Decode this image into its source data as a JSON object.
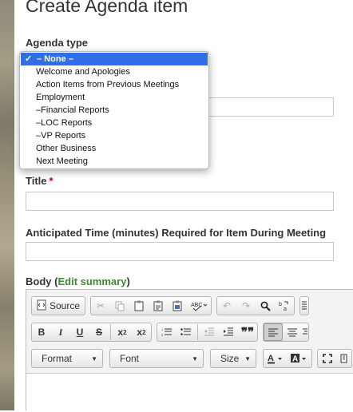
{
  "page_title": "Create Agenda item",
  "agenda_type": {
    "label": "Agenda type",
    "options": [
      "– None –",
      "Welcome and Apologies",
      "Action Items from Previous Meetings",
      "Employment",
      "–Financial Reports",
      "–LOC Reports",
      "–VP Reports",
      "Other Business",
      "Next Meeting"
    ],
    "selected": "– None –"
  },
  "title_field": {
    "label": "Title",
    "required_mark": "*"
  },
  "time_field": {
    "label": "Anticipated Time (minutes) Required for Item During Meeting"
  },
  "body": {
    "label": "Body",
    "edit_summary": "Edit summary",
    "open_paren": "(",
    "close_paren": ")"
  },
  "toolbar": {
    "source_label": "Source",
    "format_label": "Format",
    "font_label": "Font",
    "size_label": "Size"
  }
}
